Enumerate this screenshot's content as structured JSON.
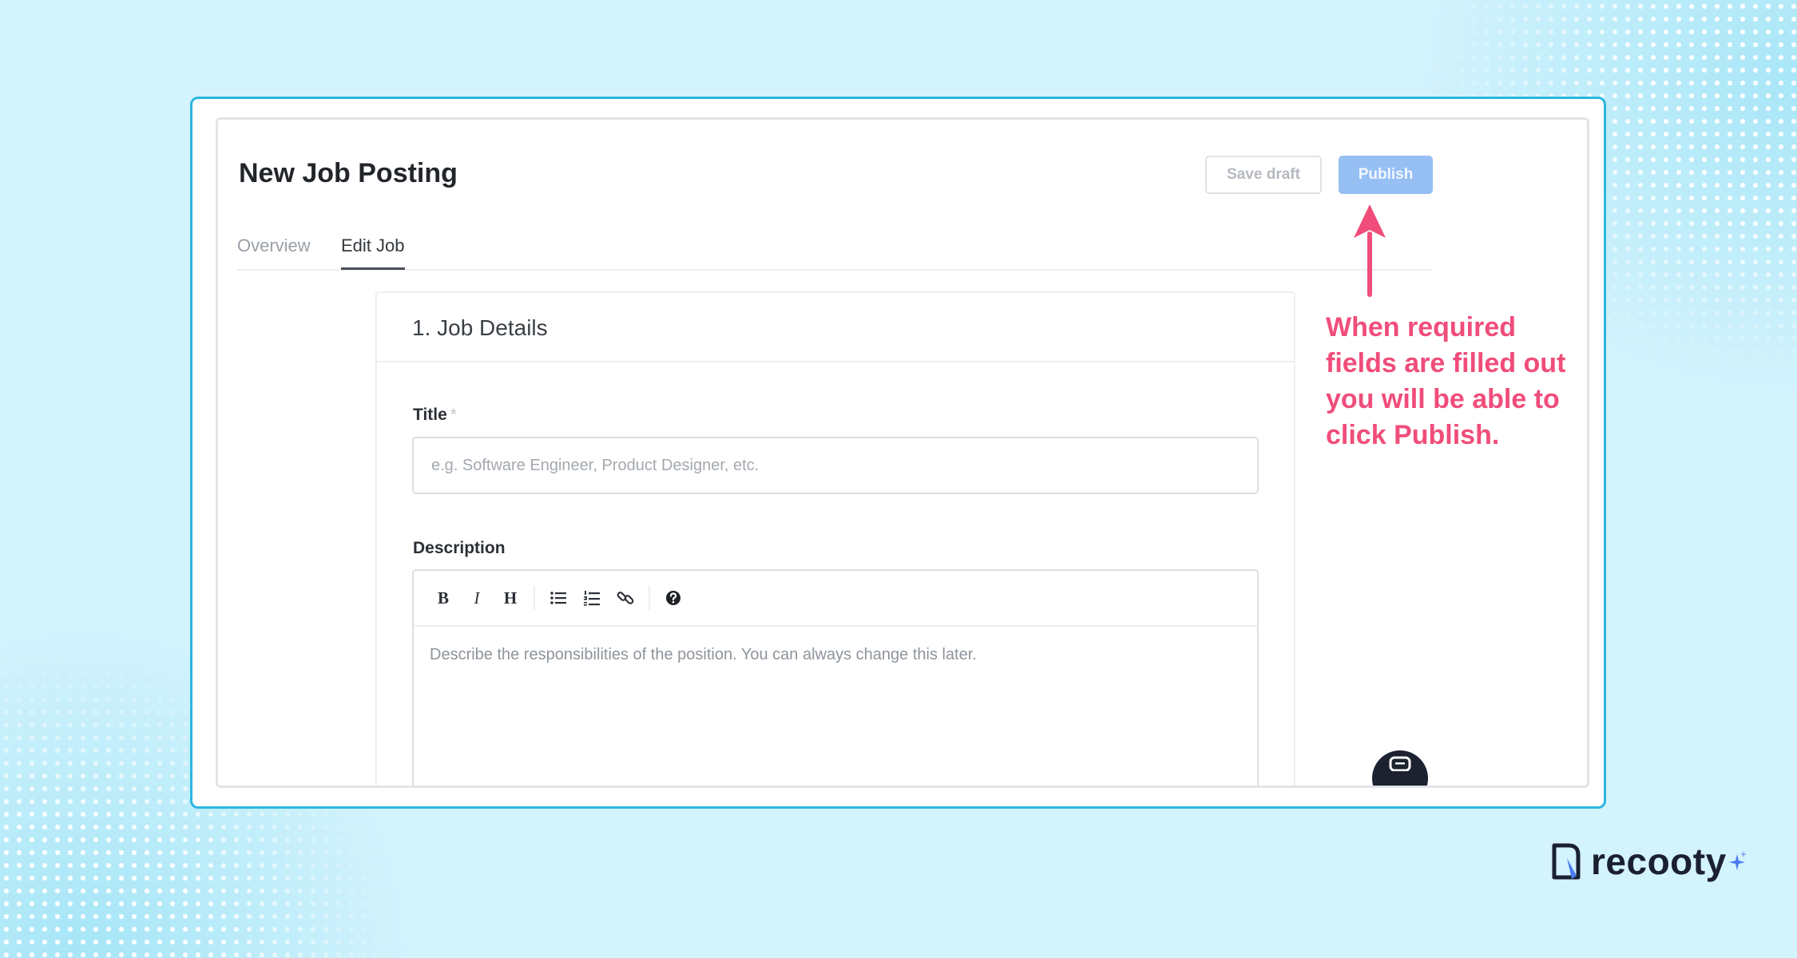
{
  "app": {
    "page_title": "New Job Posting",
    "save_draft_label": "Save draft",
    "publish_label": "Publish",
    "tabs": [
      {
        "label": "Overview",
        "active": false
      },
      {
        "label": "Edit Job",
        "active": true
      }
    ]
  },
  "job_details": {
    "section_title": "1. Job Details",
    "title_label": "Title",
    "required_mark": "*",
    "title_placeholder": "e.g. Software Engineer, Product Designer, etc.",
    "title_value": "",
    "description_label": "Description",
    "toolbar": [
      "bold-icon",
      "italic-icon",
      "heading-icon",
      "bulleted-list-icon",
      "numbered-list-icon",
      "link-icon",
      "help-icon"
    ],
    "description_placeholder": "Describe the responsibilities of the position. You can always change this later."
  },
  "annotation": {
    "lines": [
      "When required",
      "fields are filled out",
      "you will be able to",
      "click Publish."
    ]
  },
  "branding": {
    "logo_text": "recooty"
  },
  "colors": {
    "background": "#d3f3fd",
    "frame_border": "#2cb6e0",
    "publish_button": "#96bff4",
    "annotation": "#f04d7a",
    "chat_bubble": "#1d2230"
  }
}
